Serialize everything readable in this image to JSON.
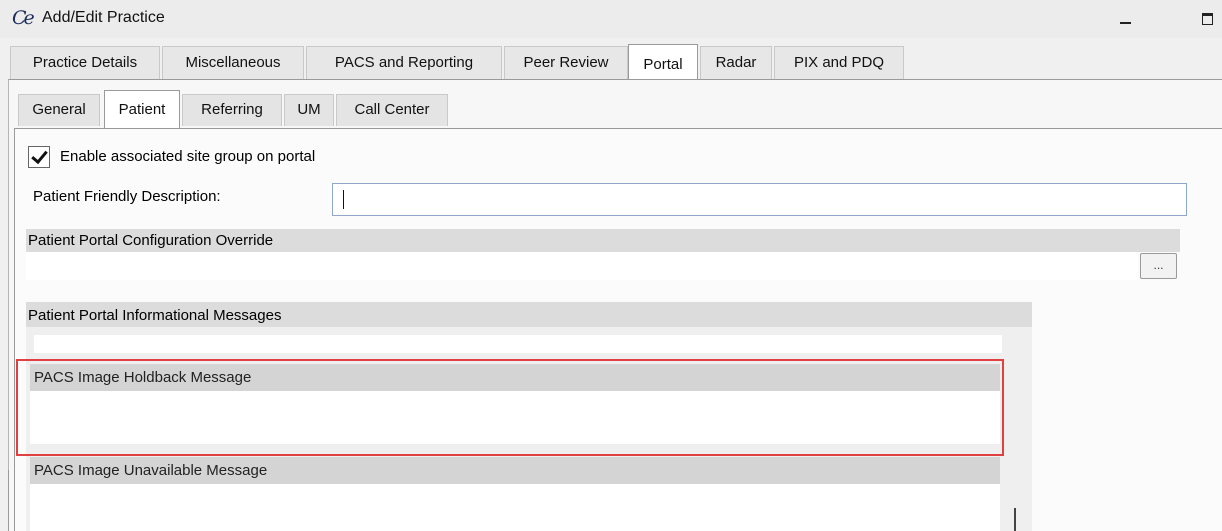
{
  "window": {
    "title": "Add/Edit Practice",
    "icon": "ce-logo-icon",
    "minimize_glyph": "minimize-icon",
    "maximize_glyph": "maximize-icon"
  },
  "outer_tabs": [
    {
      "label": "Practice Details",
      "active": false
    },
    {
      "label": "Miscellaneous",
      "active": false
    },
    {
      "label": "PACS and Reporting",
      "active": false
    },
    {
      "label": "Peer Review",
      "active": false
    },
    {
      "label": "Portal",
      "active": true
    },
    {
      "label": "Radar",
      "active": false
    },
    {
      "label": "PIX and PDQ",
      "active": false
    }
  ],
  "inner_tabs": [
    {
      "label": "General",
      "active": false
    },
    {
      "label": "Patient",
      "active": true
    },
    {
      "label": "Referring",
      "active": false
    },
    {
      "label": "UM",
      "active": false
    },
    {
      "label": "Call Center",
      "active": false
    }
  ],
  "patient": {
    "enable_checkbox_label": "Enable associated site group on portal",
    "enable_checked": true,
    "friendly_description_label": "Patient Friendly Description:",
    "friendly_description_value": "",
    "config_override_header": "Patient Portal Configuration Override",
    "config_override_value": "",
    "ellipsis_label": "...",
    "messages_header": "Patient Portal Informational Messages",
    "holdback_header": "PACS Image Holdback Message",
    "holdback_value": "",
    "unavailable_header": "PACS Image Unavailable Message",
    "unavailable_value": ""
  },
  "colors": {
    "highlight_border": "#e04040",
    "input_border": "#8fa7c9",
    "group_header_bg": "#dcdcdc"
  }
}
